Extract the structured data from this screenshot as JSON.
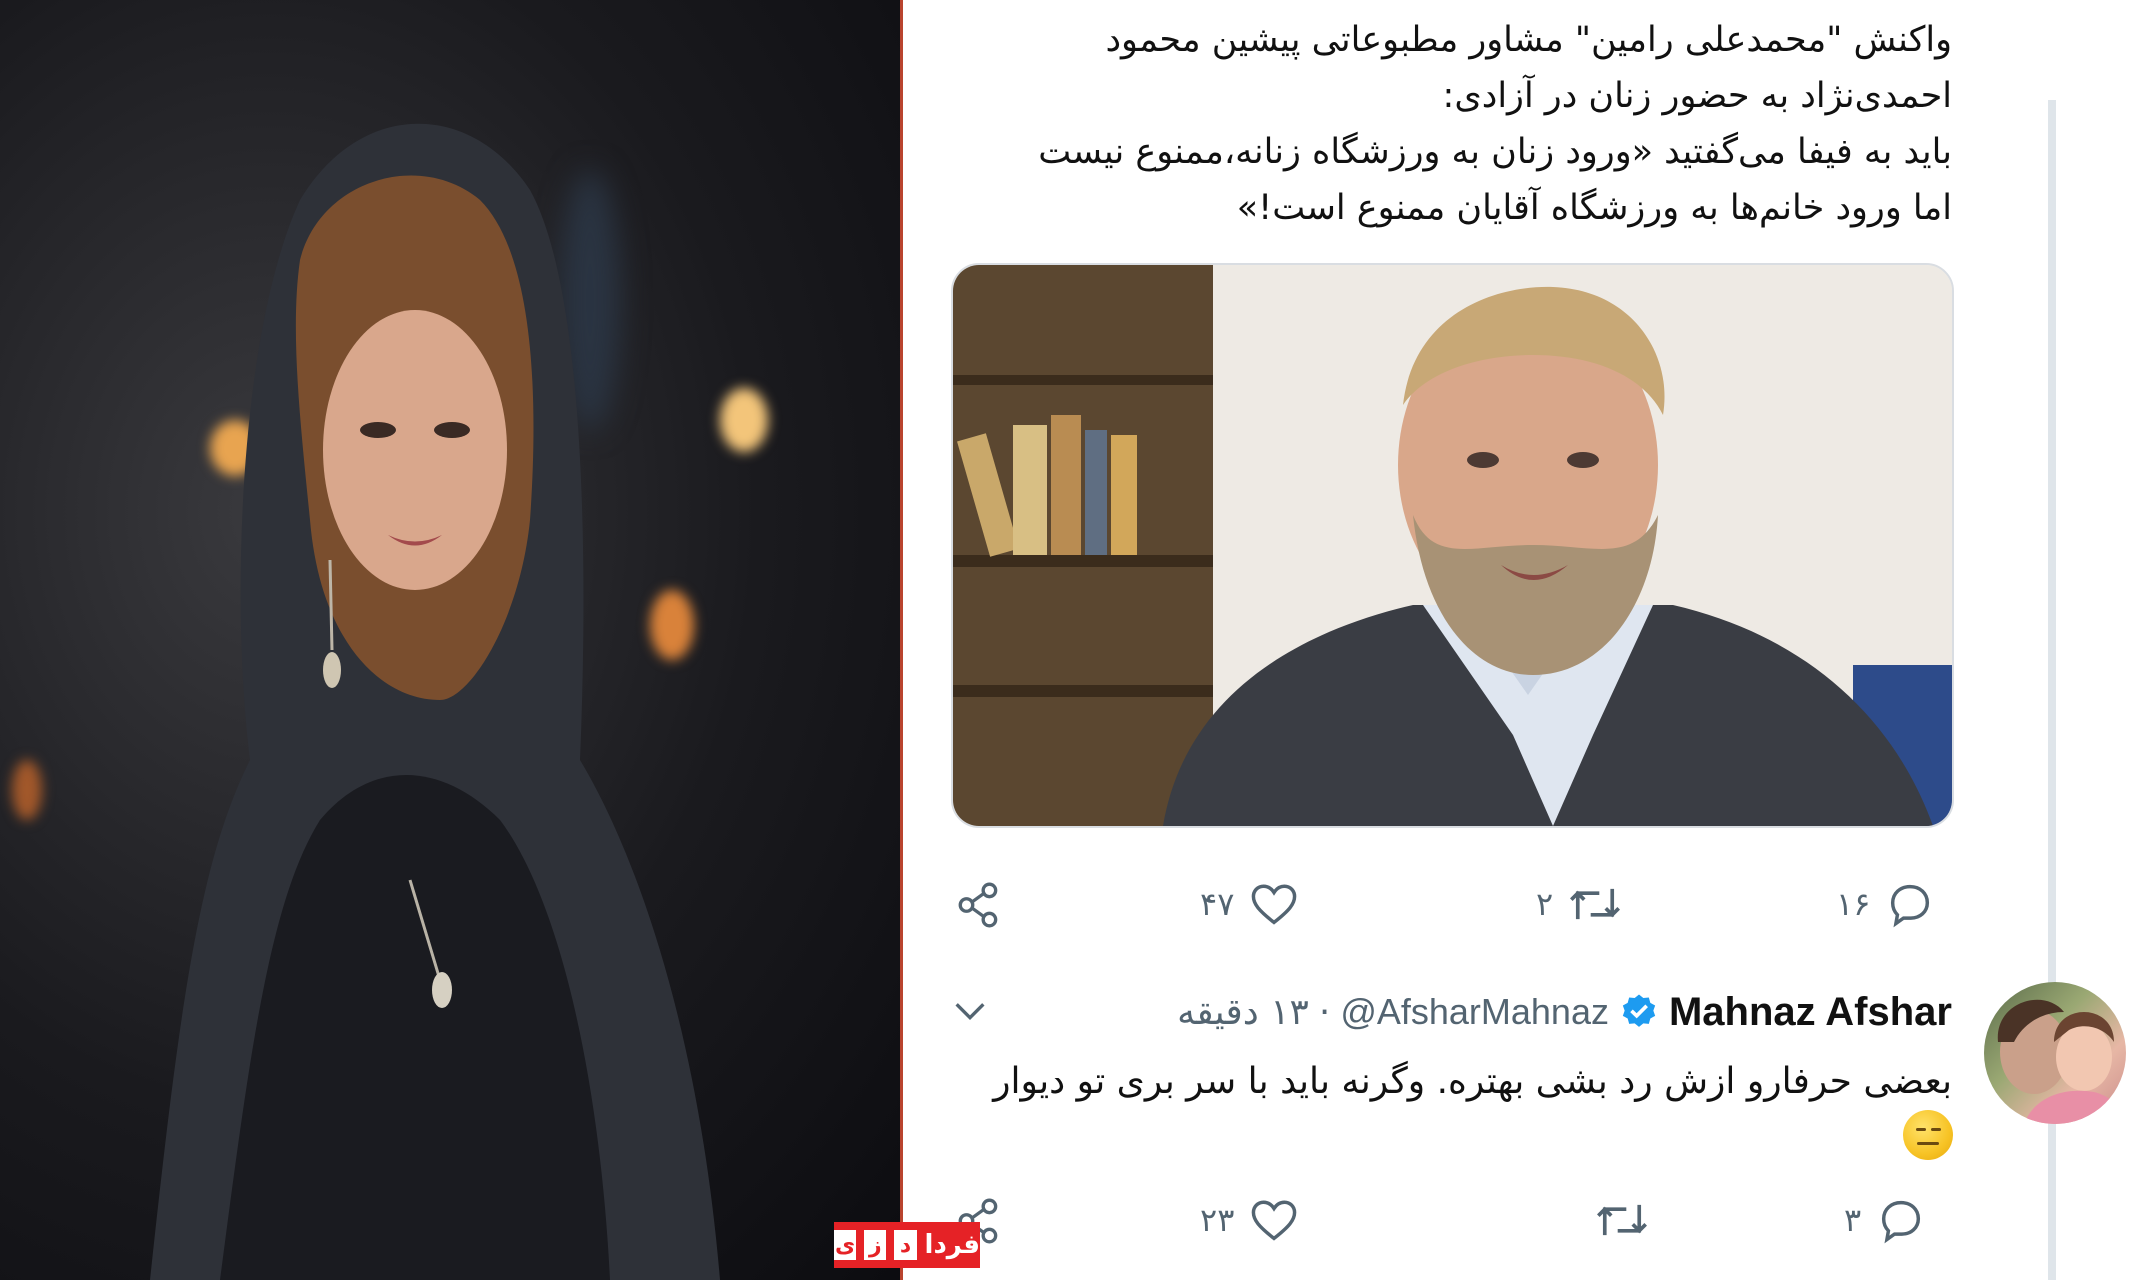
{
  "tweet1": {
    "lines": [
      "واکنش \"محمدعلی رامین\" مشاور مطبوعاتی پیشین محمود",
      "احمدی‌نژاد به حضور زنان در آزادی:",
      "باید به فیفا می‌گفتید «ورود زنان به ورزشگاه زنانه،ممنوع نیست",
      "اما ورود خانم‌ها به ورزشگاه آقایان ممنوع است!»"
    ],
    "actions": {
      "reply_count": "۱۶",
      "retweet_count": "۲",
      "like_count": "۴۷"
    }
  },
  "reply": {
    "name": "Mahnaz Afshar",
    "handle": "@AfsharMahnaz",
    "separator": "·",
    "time": "۱۳ دقیقه",
    "lines": [
      "بعضی حرفارو ازش رد بشی بهتره. وگرنه باید با سر بری تو دیوار"
    ],
    "emoji": "neutral-face",
    "actions": {
      "reply_count": "۳",
      "retweet_count": "",
      "like_count": "۲۳"
    }
  },
  "watermark": {
    "word": "فردا",
    "letters": [
      "ی",
      "ز",
      "د"
    ]
  },
  "colors": {
    "icon": "#536471",
    "verified": "#1d9bf0",
    "watermark": "#e52226",
    "thread_line": "#dfe5ea"
  }
}
